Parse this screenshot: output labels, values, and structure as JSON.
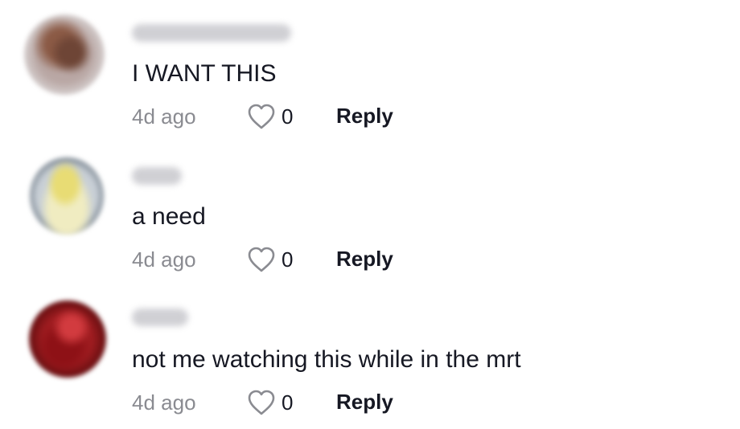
{
  "comments": [
    {
      "text": "I WANT THIS",
      "time": "4d ago",
      "likes": "0",
      "reply_label": "Reply",
      "like_icon": "heart-outline-icon"
    },
    {
      "text": "a need",
      "time": "4d ago",
      "likes": "0",
      "reply_label": "Reply",
      "like_icon": "heart-outline-icon"
    },
    {
      "text": "not me watching this while in the mrt",
      "time": "4d ago",
      "likes": "0",
      "reply_label": "Reply",
      "like_icon": "heart-outline-icon"
    }
  ],
  "colors": {
    "text_primary": "#161823",
    "text_secondary": "#8a8b91",
    "blurred_username": "#c8c8cd"
  }
}
